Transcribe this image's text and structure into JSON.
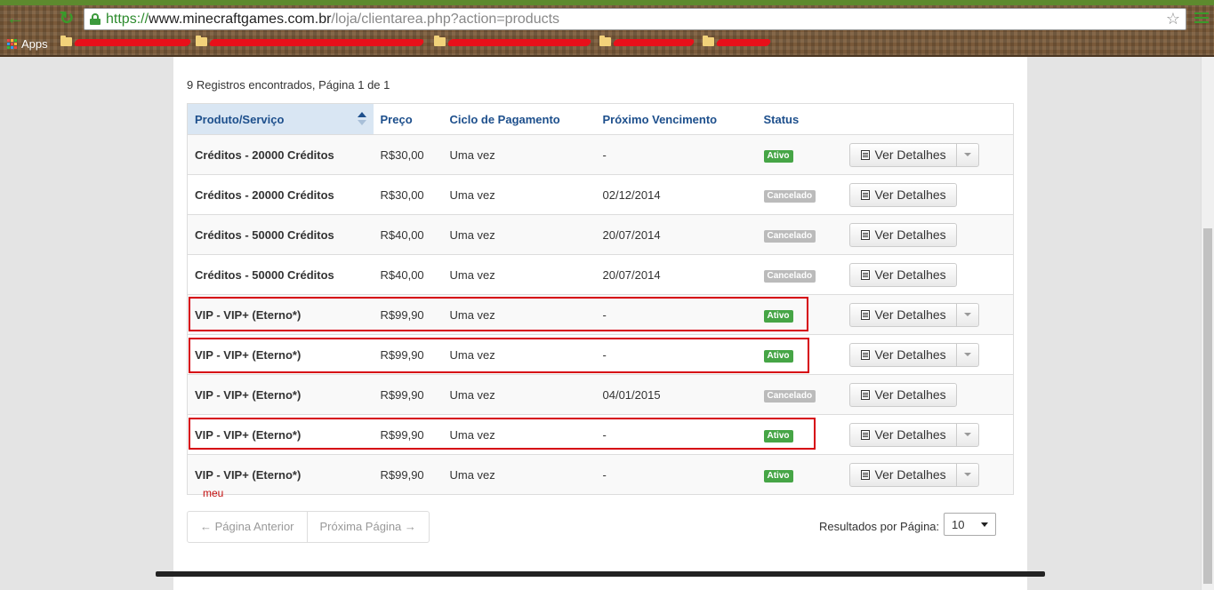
{
  "browser": {
    "url_scheme": "https://",
    "url_host": "www.minecraftgames.com.br",
    "url_path": "/loja/clientarea.php?action=products",
    "apps_label": "Apps"
  },
  "main": {
    "records_text": "9 Registros encontrados, Página 1 de 1",
    "columns": [
      "Produto/Serviço",
      "Preço",
      "Ciclo de Pagamento",
      "Próximo Vencimento",
      "Status"
    ],
    "rows": [
      {
        "product": "Créditos - 20000 Créditos",
        "price": "R$30,00",
        "cycle": "Uma vez",
        "due": "-",
        "status": "Ativo",
        "details": "Ver Detalhes"
      },
      {
        "product": "Créditos - 20000 Créditos",
        "price": "R$30,00",
        "cycle": "Uma vez",
        "due": "02/12/2014",
        "status": "Cancelado",
        "details": "Ver Detalhes"
      },
      {
        "product": "Créditos - 50000 Créditos",
        "price": "R$40,00",
        "cycle": "Uma vez",
        "due": "20/07/2014",
        "status": "Cancelado",
        "details": "Ver Detalhes"
      },
      {
        "product": "Créditos - 50000 Créditos",
        "price": "R$40,00",
        "cycle": "Uma vez",
        "due": "20/07/2014",
        "status": "Cancelado",
        "details": "Ver Detalhes"
      },
      {
        "product": "VIP - VIP+ (Eterno*)",
        "price": "R$99,90",
        "cycle": "Uma vez",
        "due": "-",
        "status": "Ativo",
        "details": "Ver Detalhes"
      },
      {
        "product": "VIP - VIP+ (Eterno*)",
        "price": "R$99,90",
        "cycle": "Uma vez",
        "due": "-",
        "status": "Ativo",
        "details": "Ver Detalhes"
      },
      {
        "product": "VIP - VIP+ (Eterno*)",
        "price": "R$99,90",
        "cycle": "Uma vez",
        "due": "04/01/2015",
        "status": "Cancelado",
        "details": "Ver Detalhes"
      },
      {
        "product": "VIP - VIP+ (Eterno*)",
        "price": "R$99,90",
        "cycle": "Uma vez",
        "due": "-",
        "status": "Ativo",
        "details": "Ver Detalhes"
      },
      {
        "product": "VIP - VIP+ (Eterno*)",
        "price": "R$99,90",
        "cycle": "Uma vez",
        "due": "-",
        "status": "Ativo",
        "details": "Ver Detalhes"
      }
    ],
    "annotation": "meu"
  },
  "pagination": {
    "prev_label": "← Página Anterior",
    "next_label": "Próxima Página →",
    "per_page_label": "Resultados por Página:",
    "per_page_value": "10"
  },
  "colors": {
    "header_text": "#1d4f8c",
    "status_active": "#46a546",
    "status_cancelled": "#bbbbbb",
    "annotation_red": "#d6000f"
  }
}
